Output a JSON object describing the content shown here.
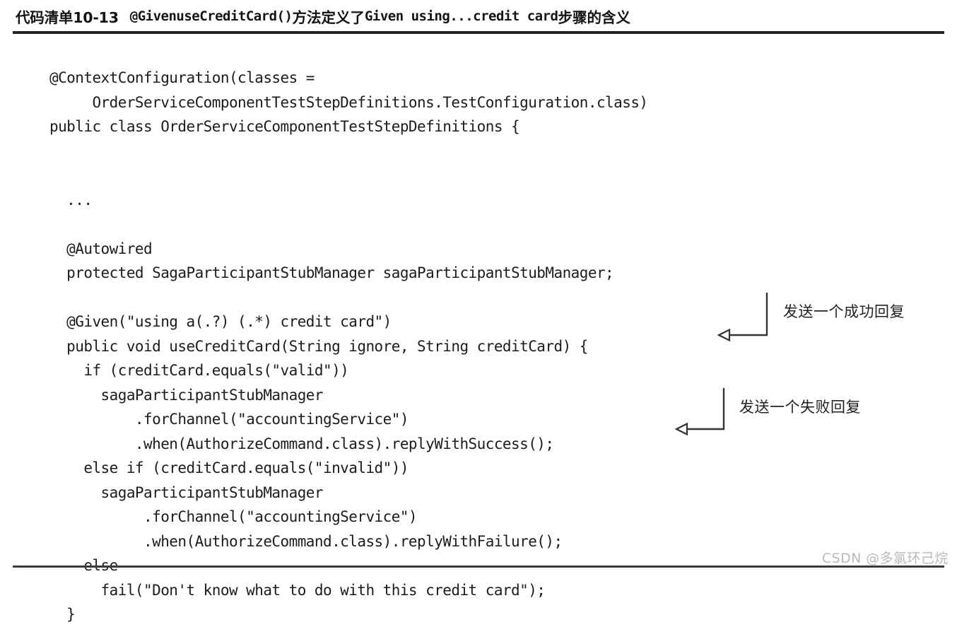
{
  "caption": {
    "label": "代码清单10-13",
    "code_fragment": "@GivenuseCreditCard()",
    "middle_cjk": "方法定义了",
    "code_fragment2": "Given using...credit card",
    "trailing_cjk": "步骤的含义",
    "full_text": "代码清单10-13  @GivenuseCreditCard()方法定义了Given using...credit card步骤的含义"
  },
  "code": {
    "language": "java",
    "lines": [
      "@ContextConfiguration(classes =",
      "     OrderServiceComponentTestStepDefinitions.TestConfiguration.class)",
      "public class OrderServiceComponentTestStepDefinitions {",
      "",
      "",
      "  ...",
      "",
      "  @Autowired",
      "  protected SagaParticipantStubManager sagaParticipantStubManager;",
      "",
      "  @Given(\"using a(.?) (.*) credit card\")",
      "  public void useCreditCard(String ignore, String creditCard) {",
      "    if (creditCard.equals(\"valid\"))",
      "      sagaParticipantStubManager",
      "          .forChannel(\"accountingService\")",
      "          .when(AuthorizeCommand.class).replyWithSuccess();",
      "    else if (creditCard.equals(\"invalid\"))",
      "      sagaParticipantStubManager",
      "           .forChannel(\"accountingService\")",
      "           .when(AuthorizeCommand.class).replyWithFailure();",
      "    else",
      "      fail(\"Don't know what to do with this credit card\");",
      "  }"
    ]
  },
  "annotations": [
    {
      "id": "success-reply",
      "text": "发送一个成功回复",
      "points_to_line": ".when(AuthorizeCommand.class).replyWithSuccess();"
    },
    {
      "id": "failure-reply",
      "text": "发送一个失败回复",
      "points_to_line": ".when(AuthorizeCommand.class).replyWithFailure();"
    }
  ],
  "watermark": {
    "text": "CSDN @多氯环己烷"
  },
  "colors": {
    "page_background": "#ffffff",
    "text": "#1c1c1c",
    "rule": "#222222",
    "watermark": "#b9b9b9",
    "annotation": "#222222"
  }
}
